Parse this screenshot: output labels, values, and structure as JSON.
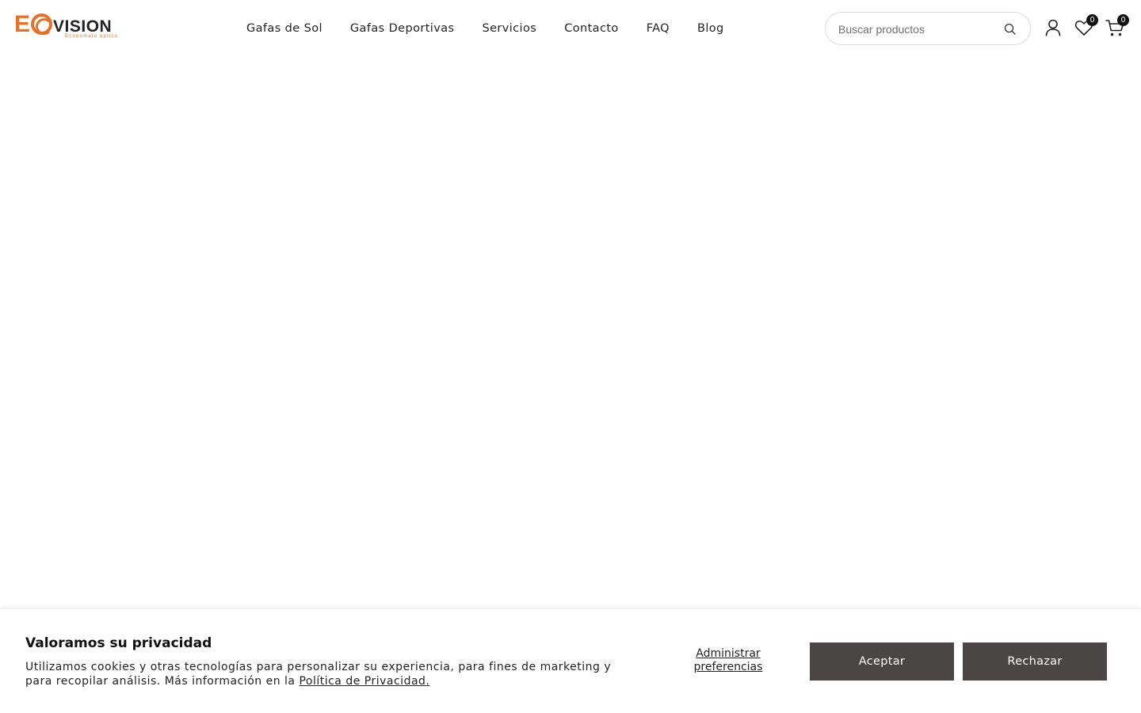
{
  "brand": {
    "logo_lead": "E",
    "logo_rest": "VISION",
    "logo_tagline": "Economato óptico",
    "accent_color": "#e8712a"
  },
  "nav": {
    "items": [
      {
        "label": "Gafas de Sol"
      },
      {
        "label": "Gafas Deportivas"
      },
      {
        "label": "Servicios"
      },
      {
        "label": "Contacto"
      },
      {
        "label": "FAQ"
      },
      {
        "label": "Blog"
      }
    ]
  },
  "search": {
    "placeholder": "Buscar productos",
    "value": "",
    "icon": "search-icon"
  },
  "header_icons": {
    "account": {
      "icon": "user-icon"
    },
    "wishlist": {
      "icon": "heart-icon",
      "count": "0"
    },
    "cart": {
      "icon": "cart-icon",
      "count": "0"
    }
  },
  "cookie_banner": {
    "title": "Valoramos su privacidad",
    "text": "Utilizamos cookies y otras tecnologías para personalizar su experiencia, para fines de marketing y para recopilar análisis. Más información en la ",
    "policy_link": "Política de Privacidad.",
    "manage_label": "Administrar preferencias",
    "accept_label": "Aceptar",
    "reject_label": "Rechazar",
    "button_color": "#4a4646"
  }
}
